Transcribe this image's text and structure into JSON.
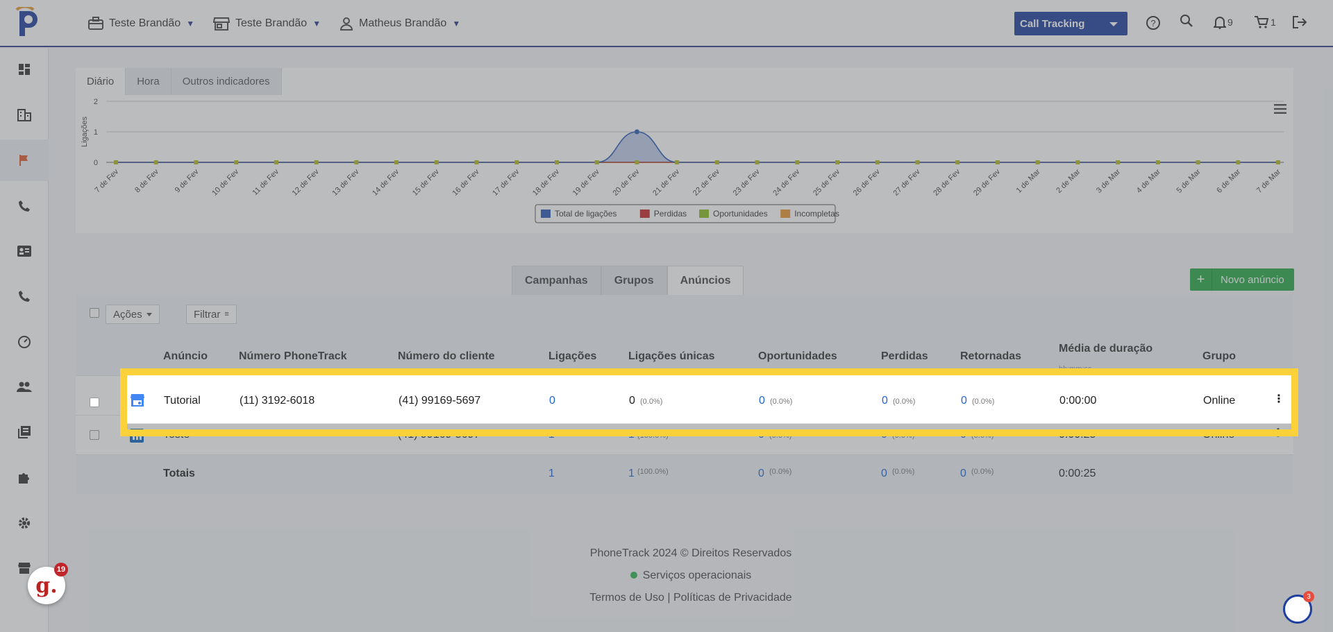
{
  "topbar": {
    "menus": [
      {
        "label": "Teste Brandão",
        "icon": "briefcase-icon"
      },
      {
        "label": "Teste Brandão",
        "icon": "store-icon"
      },
      {
        "label": "Matheus Brandão",
        "icon": "user-icon"
      }
    ],
    "product_select": "Call Tracking",
    "notifications_count": "9",
    "cart_count": "1"
  },
  "sidebar": {
    "items": [
      "dashboard-icon",
      "building-icon",
      "flag-icon",
      "phone-icon",
      "contact-card-icon",
      "phone-icon",
      "gauge-icon",
      "users-icon",
      "library-icon",
      "puzzle-icon",
      "settings-icon",
      "store-icon"
    ]
  },
  "chart_tabs": [
    "Diário",
    "Hora",
    "Outros indicadores"
  ],
  "chart_data": {
    "type": "area",
    "ylabel": "Ligações",
    "ylim": [
      0,
      2
    ],
    "yticks": [
      "0",
      "1",
      "2"
    ],
    "categories": [
      "7 de Fev",
      "8 de Fev",
      "9 de Fev",
      "10 de Fev",
      "11 de Fev",
      "12 de Fev",
      "13 de Fev",
      "14 de Fev",
      "15 de Fev",
      "16 de Fev",
      "17 de Fev",
      "18 de Fev",
      "19 de Fev",
      "20 de Fev",
      "21 de Fev",
      "22 de Fev",
      "23 de Fev",
      "24 de Fev",
      "25 de Fev",
      "26 de Fev",
      "27 de Fev",
      "28 de Fev",
      "29 de Fev",
      "1 de Mar",
      "2 de Mar",
      "3 de Mar",
      "4 de Mar",
      "5 de Mar",
      "6 de Mar",
      "7 de Mar"
    ],
    "series": [
      {
        "name": "Total de ligações",
        "color": "#2a5bb5",
        "values": [
          0,
          0,
          0,
          0,
          0,
          0,
          0,
          0,
          0,
          0,
          0,
          0,
          0,
          1,
          0,
          0,
          0,
          0,
          0,
          0,
          0,
          0,
          0,
          0,
          0,
          0,
          0,
          0,
          0,
          0
        ]
      },
      {
        "name": "Perdidas",
        "color": "#c62828",
        "values": [
          0,
          0,
          0,
          0,
          0,
          0,
          0,
          0,
          0,
          0,
          0,
          0,
          0,
          0,
          0,
          0,
          0,
          0,
          0,
          0,
          0,
          0,
          0,
          0,
          0,
          0,
          0,
          0,
          0,
          0
        ]
      },
      {
        "name": "Oportunidades",
        "color": "#8bbd1e",
        "values": [
          0,
          0,
          0,
          0,
          0,
          0,
          0,
          0,
          0,
          0,
          0,
          0,
          0,
          0,
          0,
          0,
          0,
          0,
          0,
          0,
          0,
          0,
          0,
          0,
          0,
          0,
          0,
          0,
          0,
          0
        ]
      },
      {
        "name": "Incompletas",
        "color": "#e8962d",
        "values": [
          0,
          0,
          0,
          0,
          0,
          0,
          0,
          0,
          0,
          0,
          0,
          0,
          0,
          0,
          0,
          0,
          0,
          0,
          0,
          0,
          0,
          0,
          0,
          0,
          0,
          0,
          0,
          0,
          0,
          0
        ]
      }
    ],
    "legend_position": "bottom-center",
    "grid": true
  },
  "sub_tabs": [
    "Campanhas",
    "Grupos",
    "Anúncios"
  ],
  "new_button": "Novo anúncio",
  "actions_label": "Ações",
  "filter_label": "Filtrar",
  "table": {
    "headers": [
      "Anúncio",
      "Número PhoneTrack",
      "Número do cliente",
      "Ligações",
      "Ligações únicas",
      "Oportunidades",
      "Perdidas",
      "Retornadas",
      "Média de duração",
      "Grupo"
    ],
    "header_sub": "hh:mm:ss",
    "rows": [
      {
        "icon": "google-business-icon",
        "name": "Tutorial",
        "phonetrack": "(11) 3192-6018",
        "cliente": "(41) 99169-5697",
        "ligacoes": "0",
        "unicas": "0",
        "unicas_pct": "(0.0%)",
        "oport": "0",
        "oport_pct": "(0.0%)",
        "perdidas": "0",
        "perdidas_pct": "(0.0%)",
        "retornadas": "0",
        "retornadas_pct": "(0.0%)",
        "media": "0:00:00",
        "grupo": "Online"
      },
      {
        "icon": "linkedin-icon",
        "name": "Teste",
        "phonetrack": "-",
        "cliente": "(41) 99169-5697",
        "ligacoes": "1",
        "unicas": "1",
        "unicas_pct": "(100.0%)",
        "oport": "0",
        "oport_pct": "(0.0%)",
        "perdidas": "0",
        "perdidas_pct": "(0.0%)",
        "retornadas": "0",
        "retornadas_pct": "(0.0%)",
        "media": "0:00:25",
        "grupo": "Online"
      }
    ],
    "totals": {
      "label": "Totais",
      "ligacoes": "1",
      "unicas": "1",
      "unicas_pct": "(100.0%)",
      "oport": "0",
      "oport_pct": "(0.0%)",
      "perdidas": "0",
      "perdidas_pct": "(0.0%)",
      "retornadas": "0",
      "retornadas_pct": "(0.0%)",
      "media": "0:00:25"
    }
  },
  "footer": {
    "copyright": "PhoneTrack 2024 © Direitos Reservados",
    "status": "Serviços operacionais",
    "links": "Termos de Uso | Políticas de Privacidade"
  },
  "badges": {
    "g_count": "19",
    "chat_count": "3"
  }
}
